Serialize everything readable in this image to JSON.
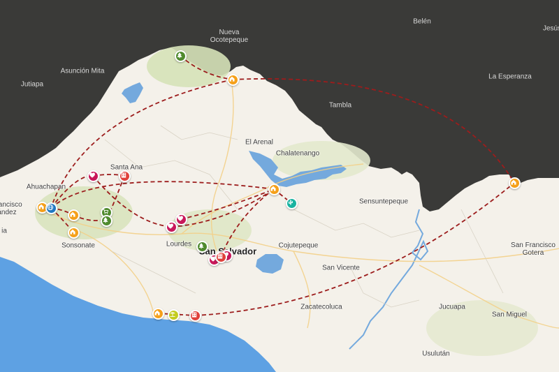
{
  "colors": {
    "land": "#f4f1ea",
    "outside": "#3a3a38",
    "sea": "#5ea1e3",
    "lake": "#74a9dd",
    "route": "#9c1c1c",
    "home": "#f5a01a",
    "park": "#4f8a2e",
    "heart": "#c8185a",
    "hotel": "#e0413c",
    "globe": "#1f78c2",
    "cactus": "#18b3a0",
    "beach": "#c4cc1f"
  },
  "labels": [
    {
      "id": "nueva-ocotepeque",
      "text": "Nueva\nOcotepeque",
      "style": "dark"
    },
    {
      "id": "belen",
      "text": "Belén",
      "style": "dark"
    },
    {
      "id": "jesus",
      "text": "Jesús",
      "style": "dark"
    },
    {
      "id": "asuncion-mita",
      "text": "Asunción Mita",
      "style": "dark"
    },
    {
      "id": "jutiapa",
      "text": "Jutiapa",
      "style": "dark"
    },
    {
      "id": "la-esperanza",
      "text": "La Esperanza",
      "style": "dark"
    },
    {
      "id": "tambla",
      "text": "Tambla",
      "style": "dark"
    },
    {
      "id": "el-arenal",
      "text": "El Arenal",
      "style": "normal"
    },
    {
      "id": "chalatenango",
      "text": "Chalatenango",
      "style": "normal"
    },
    {
      "id": "santa-ana",
      "text": "Santa Ana",
      "style": "normal"
    },
    {
      "id": "ahuachapan",
      "text": "Ahuachapan",
      "style": "normal"
    },
    {
      "id": "francisco",
      "text": "Francisco\nández",
      "style": "normal"
    },
    {
      "id": "sonsonate",
      "text": "Sonsonate",
      "style": "normal"
    },
    {
      "id": "lourdes",
      "text": "Lourdes",
      "style": "normal"
    },
    {
      "id": "san-salvador",
      "text": "San Salvador",
      "style": "big"
    },
    {
      "id": "cojutepeque",
      "text": "Cojutepeque",
      "style": "normal"
    },
    {
      "id": "sensuntepeque",
      "text": "Sensuntepeque",
      "style": "normal"
    },
    {
      "id": "san-vicente",
      "text": "San Vicente",
      "style": "normal"
    },
    {
      "id": "zacatecoluca",
      "text": "Zacatecoluca",
      "style": "normal"
    },
    {
      "id": "jucuapa",
      "text": "Jucuapa",
      "style": "normal"
    },
    {
      "id": "san-miguel",
      "text": "San Miguel",
      "style": "normal"
    },
    {
      "id": "san-francisco-gotera",
      "text": "San Francisco\nGotera",
      "style": "normal"
    },
    {
      "id": "usulutan",
      "text": "Usulután",
      "style": "normal"
    },
    {
      "id": "ia",
      "text": "ia",
      "style": "normal"
    }
  ],
  "markers": [
    {
      "id": "m1",
      "icon": "tree",
      "kind": "park"
    },
    {
      "id": "m2",
      "icon": "home",
      "kind": "home"
    },
    {
      "id": "m3",
      "icon": "home",
      "kind": "home"
    },
    {
      "id": "m4",
      "icon": "hotel",
      "kind": "hotel"
    },
    {
      "id": "m5",
      "icon": "heart",
      "kind": "heart"
    },
    {
      "id": "m6",
      "icon": "home",
      "kind": "home"
    },
    {
      "id": "m7",
      "icon": "globe",
      "kind": "globe"
    },
    {
      "id": "m8",
      "icon": "home",
      "kind": "home"
    },
    {
      "id": "m9",
      "icon": "home",
      "kind": "home"
    },
    {
      "id": "m10",
      "icon": "cart",
      "kind": "park"
    },
    {
      "id": "m11",
      "icon": "tree",
      "kind": "park"
    },
    {
      "id": "m12",
      "icon": "heart",
      "kind": "heart"
    },
    {
      "id": "m13",
      "icon": "heart",
      "kind": "heart"
    },
    {
      "id": "m14",
      "icon": "home",
      "kind": "home"
    },
    {
      "id": "m15",
      "icon": "cactus",
      "kind": "cactus"
    },
    {
      "id": "m16",
      "icon": "tree",
      "kind": "park"
    },
    {
      "id": "m17",
      "icon": "heart",
      "kind": "heart"
    },
    {
      "id": "m18",
      "icon": "heart",
      "kind": "heart"
    },
    {
      "id": "m19",
      "icon": "hotel",
      "kind": "hotel"
    },
    {
      "id": "m20",
      "icon": "home",
      "kind": "home"
    },
    {
      "id": "m21",
      "icon": "beach",
      "kind": "beach"
    },
    {
      "id": "m22",
      "icon": "hotel",
      "kind": "hotel"
    }
  ]
}
